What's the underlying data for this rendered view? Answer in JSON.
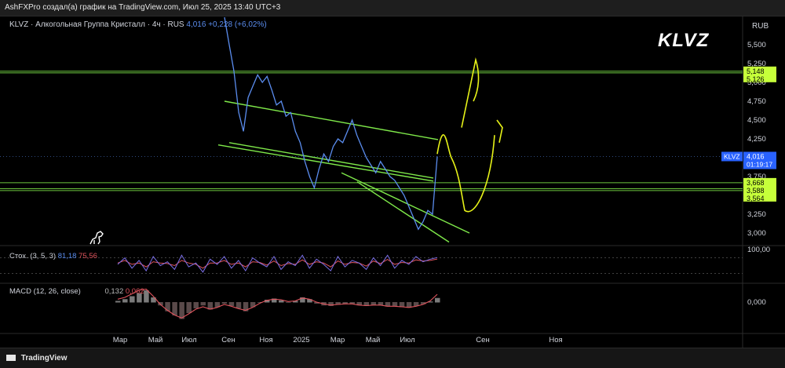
{
  "header": {
    "attribution": "AshFXPro создал(а) график на TradingView.com, Июл 25, 2025 13:40 UTC+3"
  },
  "legend": {
    "symbol_text": "KLVZ · Алкогольная Группа Кристалл · 4ч · RUS",
    "price": "4,016",
    "change": "+0,228 (+6,02%)"
  },
  "overlay_title": "KLVZ",
  "currency": "RUB",
  "stoch": {
    "label": "Стох. (3, 5, 3)",
    "k": "81,18",
    "d": "75,56",
    "axis_label": "100,00"
  },
  "macd": {
    "label": "MACD (12, 26, close)",
    "value": "0,132",
    "signal": "0,062",
    "axis_label": "0,000"
  },
  "footer": {
    "brand": "TradingView"
  },
  "colors": {
    "price": "#5b8def",
    "channel": "#7fe94a",
    "projection": "#e6f218",
    "hline": "#7fe94a"
  },
  "chart_data": {
    "type": "line",
    "title": "KLVZ · Алкогольная Группа Кристалл · 4ч · RUS",
    "currency": "RUB",
    "x_ticks": [
      "Мар",
      "Май",
      "Июл",
      "Сен",
      "Ноя",
      "2025",
      "Мар",
      "Май",
      "Июл",
      "Сен",
      "Ноя"
    ],
    "y_ticks": [
      "5,500",
      "5,250",
      "5,000",
      "4,750",
      "4,500",
      "4,250",
      "4,000",
      "3,750",
      "3,500",
      "3,250",
      "3,000"
    ],
    "ylim": [
      2.85,
      5.65
    ],
    "last_price": {
      "value": 4.016,
      "label": "4,016",
      "symbol": "KLVZ",
      "countdown": "01:19:17"
    },
    "horizontal_levels": [
      {
        "value": 5.148,
        "label": "5,148"
      },
      {
        "value": 5.126,
        "label": "5,126"
      },
      {
        "value": 3.668,
        "label": "3,668"
      },
      {
        "value": 3.588,
        "label": "3,588"
      },
      {
        "value": 3.564,
        "label": "3,564"
      }
    ],
    "series": [
      {
        "points": [
          [
            0,
            5.95
          ],
          [
            1,
            5.5
          ],
          [
            2,
            5.15
          ],
          [
            3,
            4.6
          ],
          [
            4,
            4.35
          ],
          [
            5,
            4.8
          ],
          [
            6,
            4.95
          ],
          [
            7,
            5.1
          ],
          [
            8,
            5.0
          ],
          [
            9,
            5.08
          ],
          [
            10,
            4.9
          ],
          [
            11,
            4.7
          ],
          [
            12,
            4.75
          ],
          [
            13,
            4.55
          ],
          [
            14,
            4.6
          ],
          [
            15,
            4.35
          ],
          [
            16,
            4.2
          ],
          [
            17,
            3.95
          ],
          [
            18,
            3.75
          ],
          [
            19,
            3.6
          ],
          [
            20,
            3.85
          ],
          [
            21,
            4.05
          ],
          [
            22,
            3.95
          ],
          [
            23,
            4.15
          ],
          [
            24,
            4.25
          ],
          [
            25,
            4.2
          ],
          [
            26,
            4.35
          ],
          [
            27,
            4.5
          ],
          [
            28,
            4.3
          ],
          [
            29,
            4.15
          ],
          [
            30,
            4.0
          ],
          [
            31,
            3.9
          ],
          [
            32,
            3.8
          ],
          [
            33,
            3.95
          ],
          [
            34,
            3.85
          ],
          [
            35,
            3.75
          ],
          [
            36,
            3.7
          ],
          [
            37,
            3.6
          ],
          [
            38,
            3.5
          ],
          [
            39,
            3.35
          ],
          [
            40,
            3.2
          ],
          [
            41,
            3.05
          ],
          [
            42,
            3.15
          ],
          [
            43,
            3.3
          ],
          [
            44,
            3.25
          ],
          [
            45,
            4.016
          ]
        ]
      }
    ],
    "stoch_k": [
      55,
      80,
      40,
      70,
      30,
      85,
      50,
      65,
      35,
      90,
      45,
      60,
      25,
      75,
      55,
      85,
      40,
      70,
      30,
      80,
      60,
      45,
      85,
      35,
      65,
      50,
      90,
      40,
      75,
      55,
      30,
      85,
      45,
      70,
      60,
      35,
      80,
      50,
      90,
      40,
      70,
      55,
      85,
      65,
      75,
      81.18
    ],
    "stoch_d": [
      60,
      70,
      55,
      60,
      45,
      65,
      60,
      58,
      50,
      70,
      60,
      55,
      40,
      60,
      60,
      70,
      55,
      60,
      45,
      65,
      62,
      52,
      68,
      50,
      58,
      55,
      72,
      55,
      65,
      60,
      45,
      68,
      55,
      62,
      60,
      48,
      68,
      58,
      74,
      55,
      62,
      60,
      72,
      68,
      70,
      75.56
    ],
    "macd_hist": [
      0.02,
      0.05,
      0.1,
      0.15,
      0.2,
      0.08,
      -0.05,
      -0.15,
      -0.22,
      -0.28,
      -0.18,
      -0.1,
      -0.05,
      -0.12,
      -0.08,
      -0.02,
      -0.06,
      -0.1,
      -0.15,
      -0.08,
      0.0,
      0.04,
      0.06,
      0.03,
      0.0,
      0.02,
      0.08,
      0.05,
      -0.02,
      -0.05,
      -0.06,
      -0.04,
      -0.02,
      -0.03,
      -0.05,
      -0.06,
      -0.04,
      -0.05,
      -0.07,
      -0.06,
      -0.08,
      -0.09,
      -0.06,
      -0.03,
      0.01,
      0.07
    ],
    "macd_line": [
      0.05,
      0.08,
      0.14,
      0.2,
      0.22,
      0.1,
      -0.04,
      -0.14,
      -0.22,
      -0.27,
      -0.2,
      -0.12,
      -0.08,
      -0.12,
      -0.09,
      -0.04,
      -0.07,
      -0.11,
      -0.14,
      -0.09,
      -0.02,
      0.03,
      0.05,
      0.04,
      0.01,
      0.02,
      0.07,
      0.05,
      0.0,
      -0.03,
      -0.05,
      -0.04,
      -0.03,
      -0.03,
      -0.05,
      -0.06,
      -0.05,
      -0.05,
      -0.07,
      -0.07,
      -0.08,
      -0.09,
      -0.07,
      -0.04,
      0.02,
      0.132
    ]
  }
}
